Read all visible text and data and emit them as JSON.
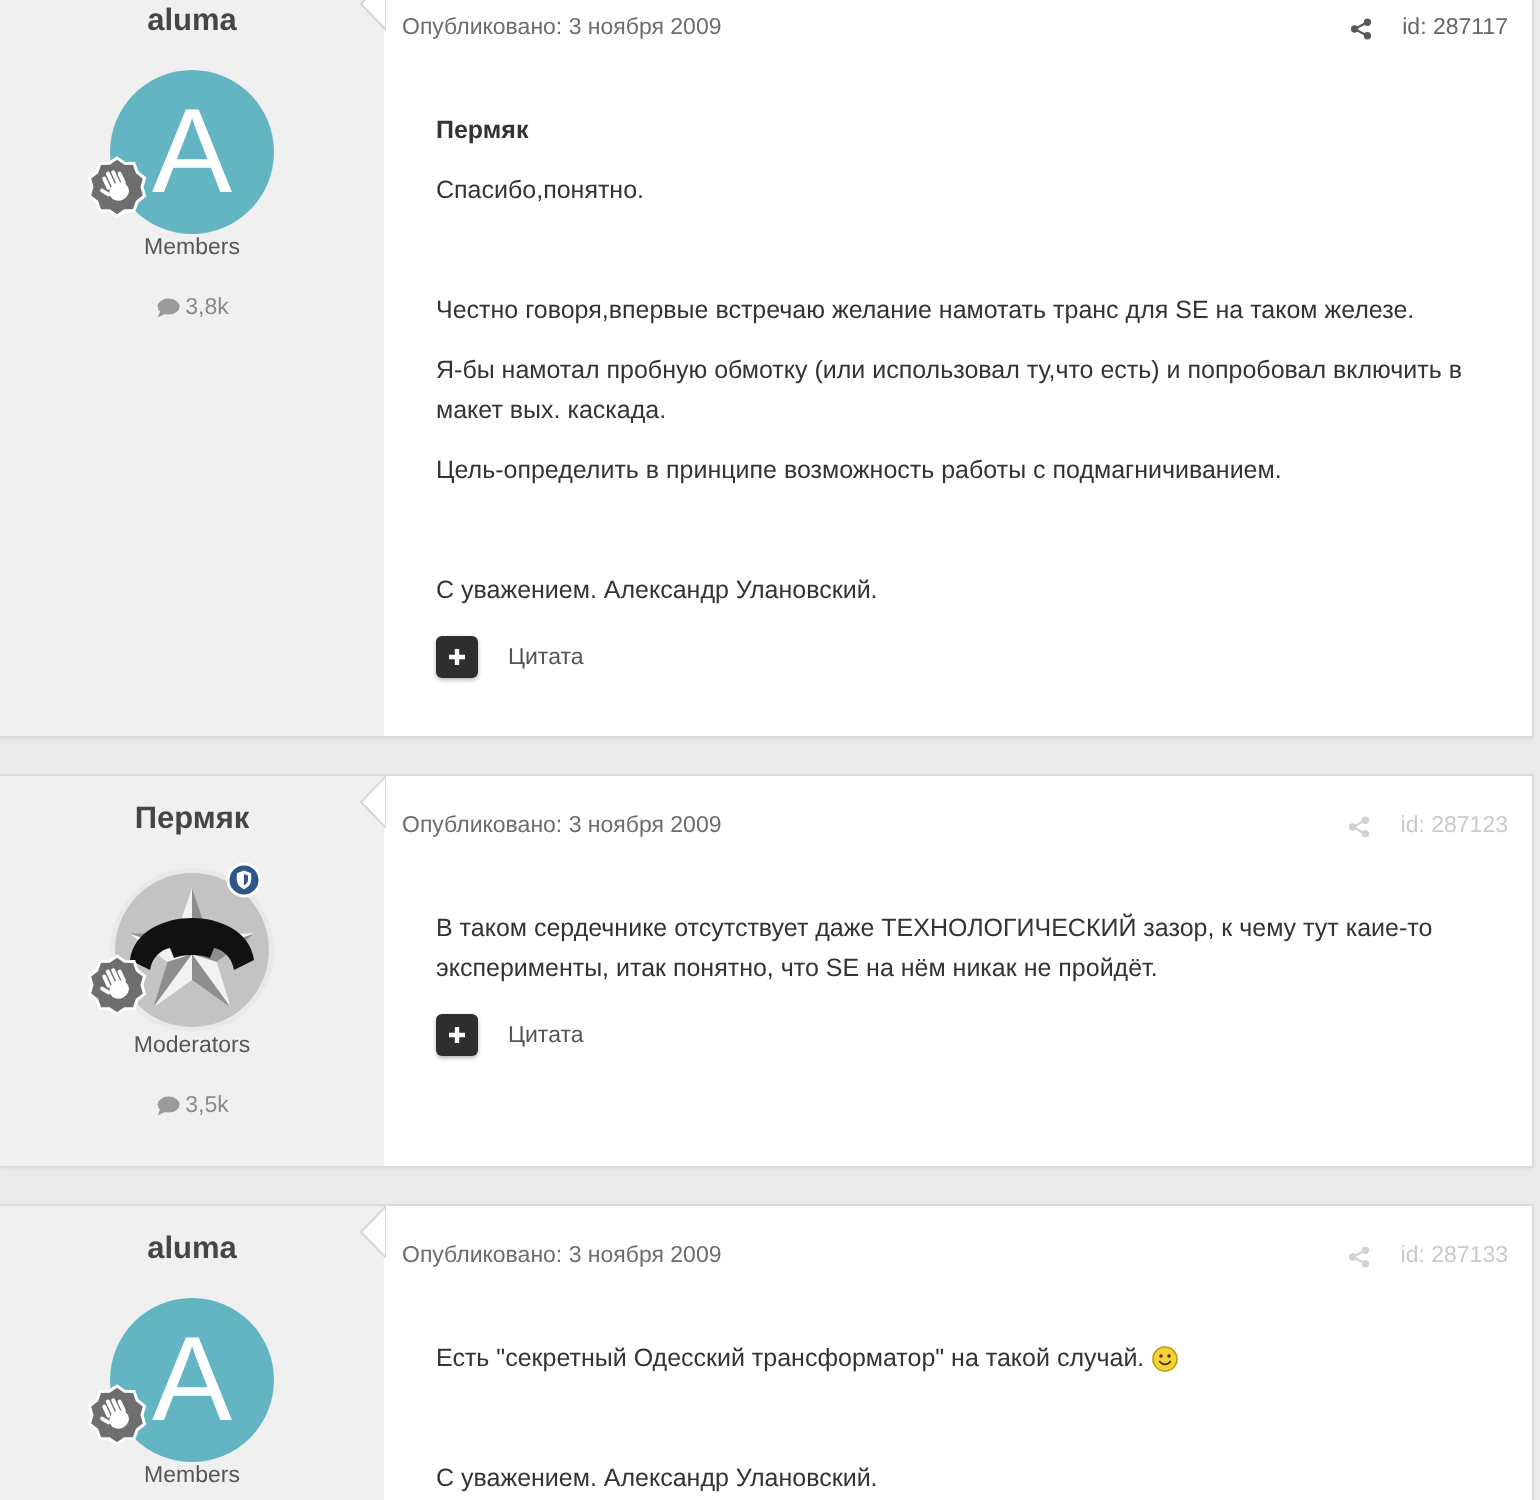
{
  "posts": [
    {
      "author": {
        "name": "aluma",
        "avatar": {
          "kind": "letter",
          "letter": "A"
        },
        "shield_badge": false,
        "group": "Members",
        "post_count": "3,8k"
      },
      "published": "Опубликовано: 3 ноября 2009",
      "id_label": "id: 287117",
      "highlighted": true,
      "blocks": [
        [
          {
            "text": "Пермяк",
            "bold": true,
            "smiley": false
          },
          {
            "text": "Спасибо,понятно.",
            "bold": false,
            "smiley": false
          }
        ],
        [
          {
            "text": "Честно говоря,впервые встречаю желание намотать транс для SE на таком железе.",
            "bold": false,
            "smiley": false
          },
          {
            "text": "Я-бы намотал пробную обмотку (или использовал ту,что есть) и попробовал включить в макет вых. каскада.",
            "bold": false,
            "smiley": false
          },
          {
            "text": "Цель-определить в принципе возможность работы с подмагничиванием.",
            "bold": false,
            "smiley": false
          }
        ],
        [
          {
            "text": "С уважением. Александр Улановский.",
            "bold": false,
            "smiley": false
          }
        ]
      ],
      "quote_label": "Цитата"
    },
    {
      "author": {
        "name": "Пермяк",
        "avatar": {
          "kind": "image"
        },
        "shield_badge": true,
        "group": "Moderators",
        "post_count": "3,5k"
      },
      "published": "Опубликовано: 3 ноября 2009",
      "id_label": "id: 287123",
      "highlighted": false,
      "blocks": [
        [
          {
            "text": "В таком сердечнике отсутствует даже ТЕХНОЛОГИЧЕСКИЙ зазор, к чему тут каие-то эксперименты, итак понятно, что SE на нём никак не пройдёт.",
            "bold": false,
            "smiley": false
          }
        ]
      ],
      "quote_label": "Цитата"
    },
    {
      "author": {
        "name": "aluma",
        "avatar": {
          "kind": "letter",
          "letter": "A"
        },
        "shield_badge": false,
        "group": "Members"
      },
      "published": "Опубликовано: 3 ноября 2009",
      "id_label": "id: 287133",
      "highlighted": false,
      "blocks": [
        [
          {
            "text": "Есть \"секретный Одесский трансформатор\" на такой случай.",
            "bold": false,
            "smiley": true
          }
        ],
        [
          {
            "text": "С уважением. Александр Улановский.",
            "bold": false,
            "smiley": false
          }
        ]
      ]
    }
  ]
}
